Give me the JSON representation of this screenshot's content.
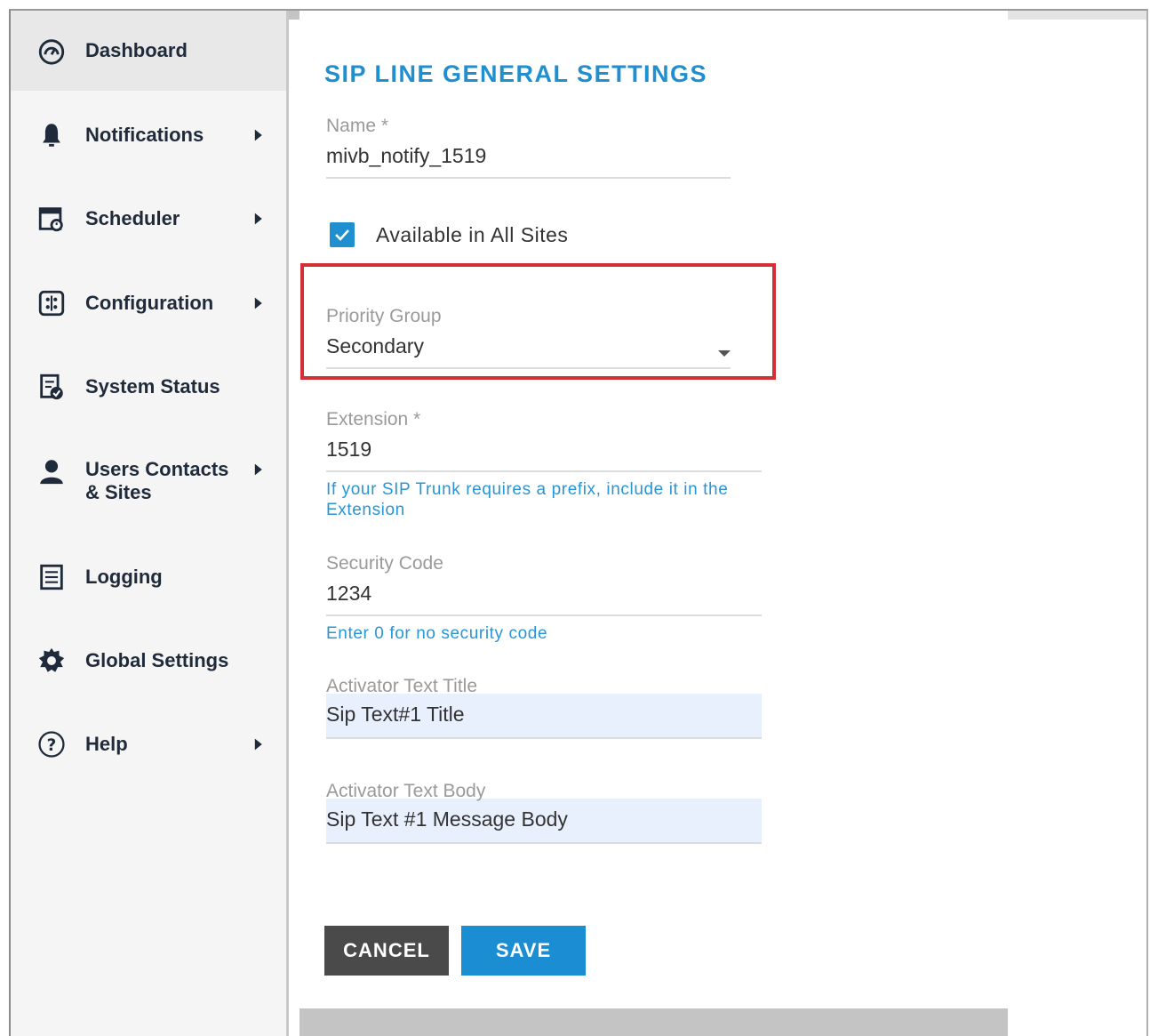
{
  "sidebar": {
    "items": [
      {
        "label": "Dashboard",
        "icon": "dashboard-gauge-icon",
        "has_submenu": false
      },
      {
        "label": "Notifications",
        "icon": "bell-icon",
        "has_submenu": true
      },
      {
        "label": "Scheduler",
        "icon": "calendar-clock-icon",
        "has_submenu": true
      },
      {
        "label": "Configuration",
        "icon": "configuration-icon",
        "has_submenu": true
      },
      {
        "label": "System Status",
        "icon": "system-status-icon",
        "has_submenu": false
      },
      {
        "label": "Users Contacts",
        "label2": "& Sites",
        "icon": "user-icon",
        "has_submenu": true
      },
      {
        "label": "Logging",
        "icon": "log-list-icon",
        "has_submenu": false
      },
      {
        "label": "Global Settings",
        "icon": "gear-icon",
        "has_submenu": false
      },
      {
        "label": "Help",
        "icon": "help-icon",
        "has_submenu": true
      }
    ]
  },
  "form": {
    "title": "SIP LINE GENERAL SETTINGS",
    "name": {
      "label": "Name *",
      "value": "mivb_notify_1519"
    },
    "available_all_sites": {
      "label": "Available in All Sites",
      "checked": true
    },
    "priority_group": {
      "label": "Priority Group",
      "value": "Secondary"
    },
    "extension": {
      "label": "Extension *",
      "value": "1519",
      "hint": "If your SIP Trunk requires a prefix, include it in the Extension"
    },
    "security_code": {
      "label": "Security Code",
      "value": "1234",
      "hint": "Enter 0 for no security code"
    },
    "activator_title": {
      "label": "Activator Text Title",
      "value": "Sip Text#1 Title"
    },
    "activator_body": {
      "label": "Activator Text Body",
      "value": "Sip Text #1 Message Body"
    }
  },
  "buttons": {
    "cancel": "CANCEL",
    "save": "SAVE"
  },
  "colors": {
    "accent": "#1f8fd0",
    "highlight": "#d42f37",
    "cancel_bg": "#4a4a4a",
    "save_bg": "#1a8dd3"
  }
}
